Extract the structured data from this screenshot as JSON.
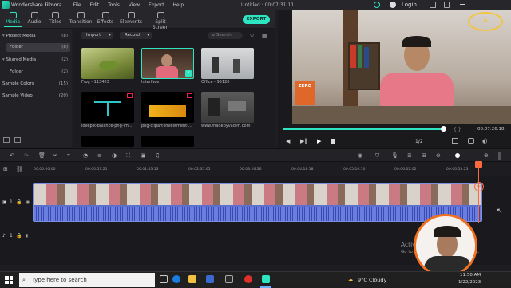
{
  "titlebar": {
    "app_name": "Wondershare Filmora",
    "menu": [
      "File",
      "Edit",
      "Tools",
      "View",
      "Export",
      "Help"
    ],
    "project_title": "Untitled : 00:07:31:11",
    "login": "Login"
  },
  "tabs": [
    {
      "label": "Media"
    },
    {
      "label": "Audio"
    },
    {
      "label": "Titles"
    },
    {
      "label": "Transition"
    },
    {
      "label": "Effects"
    },
    {
      "label": "Elements"
    },
    {
      "label": "Split Screen"
    }
  ],
  "export_label": "EXPORT",
  "sidebar": {
    "items": [
      {
        "label": "Project Media",
        "count": "(8)"
      },
      {
        "label": "Folder",
        "count": "(8)"
      },
      {
        "label": "Shared Media",
        "count": "(2)"
      },
      {
        "label": "Folder",
        "count": "(2)"
      },
      {
        "label": "Sample Colors",
        "count": "(15)"
      },
      {
        "label": "Sample Video",
        "count": "(20)"
      }
    ]
  },
  "media_toolbar": {
    "import": "Import",
    "record": "Record",
    "search_placeholder": "Search"
  },
  "media_items": [
    {
      "label": "Frog - 113403"
    },
    {
      "label": "Interface"
    },
    {
      "label": "Office - 95126"
    },
    {
      "label": "lovepik-balance-png-im..."
    },
    {
      "label": "png-clipart-investment-..."
    },
    {
      "label": "www.madebyvadim.com"
    }
  ],
  "book_text": "ZERO",
  "player": {
    "time": "00:07:26:18",
    "page": "1/2"
  },
  "ruler": [
    "00:00:00:00",
    "00:00:51:21",
    "00:01:43:13",
    "00:02:35:05",
    "00:03:26:26",
    "00:04:18:18",
    "00:05:10:10",
    "00:06:02:02",
    "00:06:53:23"
  ],
  "track_labels": {
    "video": "1",
    "audio": "1"
  },
  "activate": {
    "line1": "Activate Windows",
    "line2": "Go to Settings to activate Windows."
  },
  "taskbar": {
    "search_placeholder": "Type here to search",
    "weather": "9°C Cloudy",
    "time": "11:50 AM",
    "date": "1/22/2023"
  },
  "colors": {
    "accent": "#2ee5c2",
    "clip": "#5a6fd0",
    "playhead": "#ff6a3d"
  }
}
